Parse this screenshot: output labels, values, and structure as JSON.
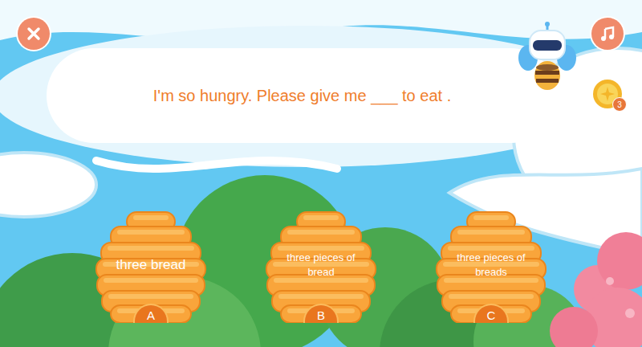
{
  "question": {
    "text": "I'm so hungry. Please give me ___ to eat ."
  },
  "coins": {
    "count": "3"
  },
  "options": [
    {
      "letter": "A",
      "text": "three bread"
    },
    {
      "letter": "B",
      "text": "three pieces of bread"
    },
    {
      "letter": "C",
      "text": "three pieces of breads"
    }
  ]
}
